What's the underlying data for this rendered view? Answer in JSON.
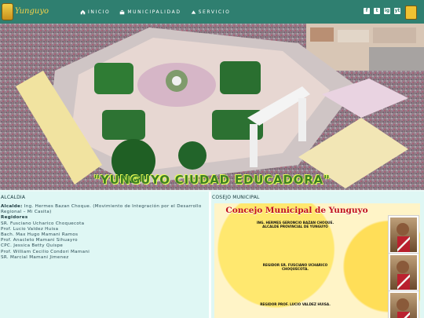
{
  "header": {
    "logo_text": "Yunguyo",
    "nav": [
      {
        "label": "INICIO"
      },
      {
        "label": "MUNICIPALIDAD"
      },
      {
        "label": "SERVICIO"
      }
    ],
    "social": [
      "f",
      "t",
      "ig",
      "yt"
    ]
  },
  "hero": {
    "title": "\"YUNGUYO CIUDAD EDUCADORA\""
  },
  "alcaldia": {
    "title": "ALCALDIA",
    "alcalde_label": "Alcalde:",
    "alcalde_text": "Ing. Hermes Bazan Choque. (Movimiento de Integración por el Desarrollo Regional – Mi Casita)",
    "regidores_label": "Regidores",
    "regidores": [
      "SR. Fusciano Ucharico Choquecota",
      "Prof. Lucio Valdez Huisa",
      "Bach. Max Hugo Mamani Ramos",
      "Prof. Anacleto Mamani Sihuayro",
      "CPC. Jessica Betty Quispe",
      "Prof. William Cecilio Condori Mamani",
      "SR. Marcial Mamani Jimenez"
    ]
  },
  "concejo": {
    "title": "COSEJO MUNICIPAL",
    "poster_title": "Concejo Municipal de Yunguyo",
    "entries": [
      {
        "line1": "ING. HERMES GERONCIO BAZAN CHOQUE.",
        "line2": "ALCALDE PROVINCIAL DE YUNGUYO"
      },
      {
        "line1": "REGIDOR SR. FUSCIANO UCHARICO",
        "line2": "CHOQUECOTA."
      },
      {
        "line1": "REGIDOR PROF. LUCIO VALDEZ HUISA.",
        "line2": ""
      }
    ]
  }
}
